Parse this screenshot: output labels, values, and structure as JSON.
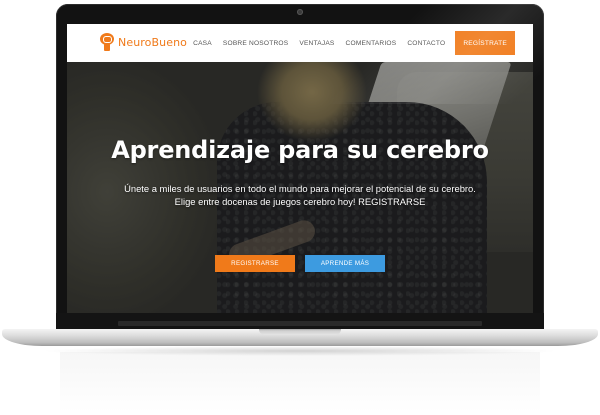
{
  "site": {
    "logo_text": "NeuroBueno",
    "logo_icon": "brain-head-icon",
    "nav": [
      {
        "label": "CASA"
      },
      {
        "label": "SOBRE NOSOTROS"
      },
      {
        "label": "VENTAJAS"
      },
      {
        "label": "COMENTARIOS"
      },
      {
        "label": "CONTACTO"
      }
    ],
    "nav_cta": "REGÍSTRATE"
  },
  "hero": {
    "title": "Aprendizaje para su cerebro",
    "subtitle_line1": "Únete a miles de usuarios en todo el mundo para mejorar el potencial de su cerebro.",
    "subtitle_line2": "Elige entre docenas de juegos cerebro hoy! REGISTRARSE",
    "primary_button": "REGISTRARSE",
    "secondary_button": "APRENDE MÁS"
  },
  "colors": {
    "accent": "#f07a1a",
    "secondary": "#3d9be0"
  }
}
